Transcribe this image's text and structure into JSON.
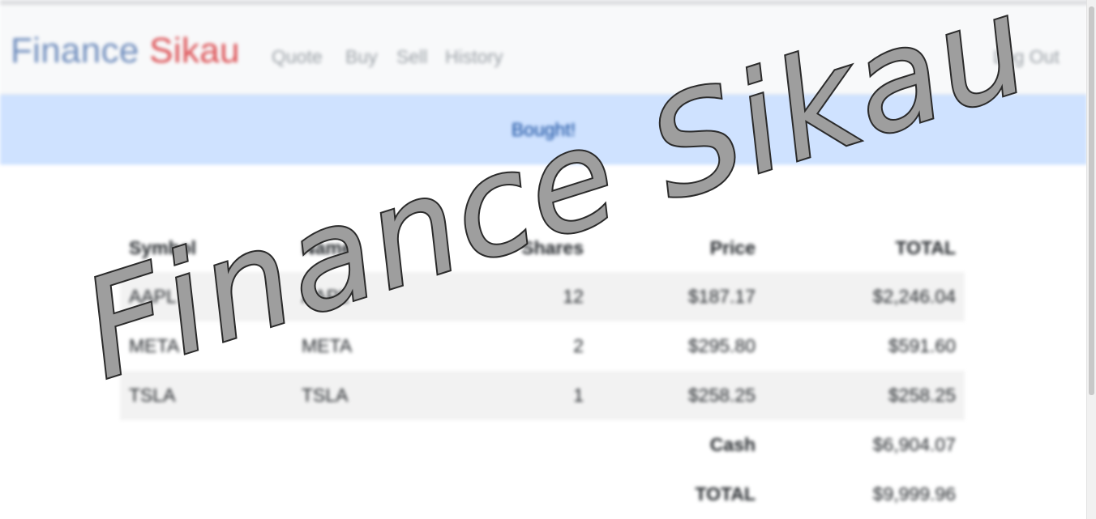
{
  "navbar": {
    "brand_part1": "Finance",
    "brand_part2": "Sikau",
    "links": [
      "Quote",
      "Buy",
      "Sell",
      "History"
    ],
    "logout": "Log Out",
    "colors": {
      "brand_blue": "#6f8dbd",
      "brand_red": "#dc4f53",
      "navbar_bg": "#f8f9fa"
    }
  },
  "alert": {
    "message": "Bought!",
    "colors": {
      "bg": "#cfe2ff",
      "text": "#084298"
    }
  },
  "portfolio": {
    "headers": [
      "Symbol",
      "Name",
      "Shares",
      "Price",
      "TOTAL"
    ],
    "rows": [
      {
        "symbol": "AAPL",
        "name": "AAPL",
        "shares": "12",
        "price": "$187.17",
        "total": "$2,246.04"
      },
      {
        "symbol": "META",
        "name": "META",
        "shares": "2",
        "price": "$295.80",
        "total": "$591.60"
      },
      {
        "symbol": "TSLA",
        "name": "TSLA",
        "shares": "1",
        "price": "$258.25",
        "total": "$258.25"
      }
    ],
    "cash_label": "Cash",
    "cash_value": "$6,904.07",
    "grand_total_label": "TOTAL",
    "grand_total_value": "$9,999.96"
  },
  "watermark": {
    "text": "Finance Sikau",
    "colors": {
      "fill": "#9e9e9e",
      "stroke": "#2b2b2b"
    }
  }
}
